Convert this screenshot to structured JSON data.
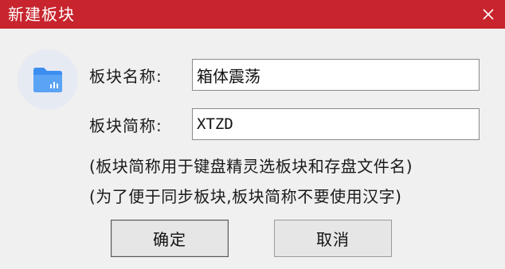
{
  "window": {
    "title": "新建板块",
    "close_icon": "close-icon"
  },
  "form": {
    "name_label": "板块名称:",
    "name_value": "箱体震荡",
    "short_label": "板块简称:",
    "short_value": "XTZD"
  },
  "notes": {
    "line1": "(板块简称用于键盘精灵选板块和存盘文件名)",
    "line2": "(为了便于同步板块,板块简称不要使用汉字)"
  },
  "buttons": {
    "ok_label": "确定",
    "cancel_label": "取消"
  },
  "colors": {
    "titlebar": "#c8242d",
    "folder_icon": "#3d8ef0"
  },
  "icons": {
    "dialog_icon": "folder-icon"
  }
}
